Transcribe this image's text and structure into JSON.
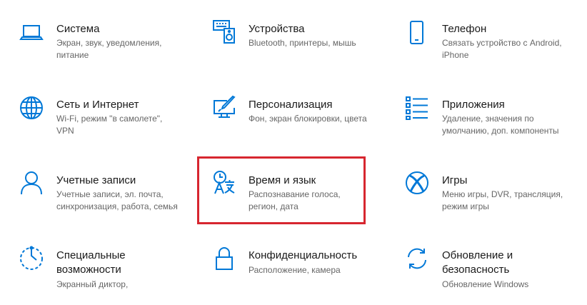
{
  "tiles": [
    {
      "title": "Система",
      "desc": "Экран, звук, уведомления, питание",
      "icon": "laptop-icon"
    },
    {
      "title": "Устройства",
      "desc": "Bluetooth, принтеры, мышь",
      "icon": "keyboard-speaker-icon"
    },
    {
      "title": "Телефон",
      "desc": "Связать устройство с Android, iPhone",
      "icon": "phone-icon"
    },
    {
      "title": "Сеть и Интернет",
      "desc": "Wi-Fi, режим \"в самолете\", VPN",
      "icon": "globe-icon"
    },
    {
      "title": "Персонализация",
      "desc": "Фон, экран блокировки, цвета",
      "icon": "paintbrush-monitor-icon"
    },
    {
      "title": "Приложения",
      "desc": "Удаление, значения по умолчанию, доп. компоненты",
      "icon": "apps-list-icon"
    },
    {
      "title": "Учетные записи",
      "desc": "Учетные записи, эл. почта, синхронизация, работа, семья",
      "icon": "person-icon"
    },
    {
      "title": "Время и язык",
      "desc": "Распознавание голоса, регион, дата",
      "icon": "time-language-icon"
    },
    {
      "title": "Игры",
      "desc": "Меню игры, DVR, трансляция, режим игры",
      "icon": "xbox-icon"
    },
    {
      "title": "Специальные возможности",
      "desc": "Экранный диктор,",
      "icon": "accessibility-icon"
    },
    {
      "title": "Конфиденциальность",
      "desc": "Расположение, камера",
      "icon": "lock-icon"
    },
    {
      "title": "Обновление и безопасность",
      "desc": "Обновление Windows",
      "icon": "sync-icon"
    }
  ],
  "colors": {
    "accent": "#0078d7",
    "highlight": "#d7262f"
  }
}
